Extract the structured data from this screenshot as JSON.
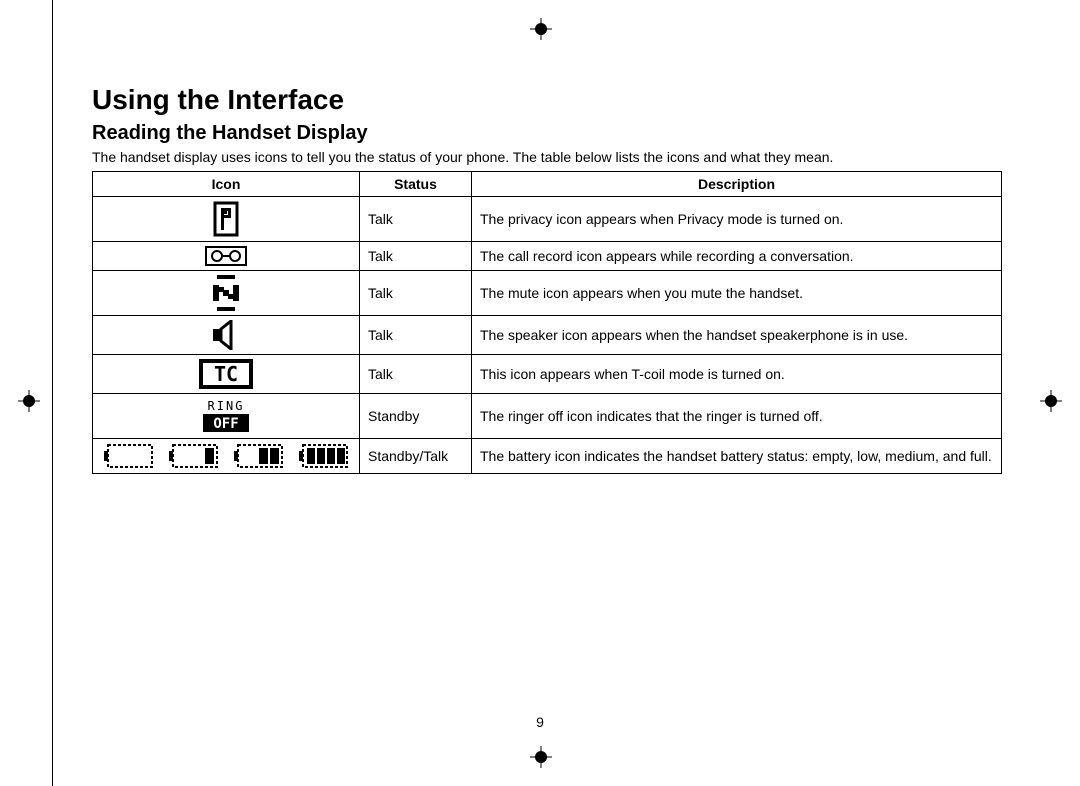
{
  "page": {
    "title": "Using the Interface",
    "section": "Reading the Handset Display",
    "intro": "The handset display uses icons to tell you the status of your phone. The table below lists the icons and what they mean.",
    "number": "9"
  },
  "table": {
    "headers": {
      "icon": "Icon",
      "status": "Status",
      "description": "Description"
    },
    "rows": [
      {
        "icon_name": "privacy-icon",
        "status": "Talk",
        "description": "The privacy icon appears when Privacy mode is turned on."
      },
      {
        "icon_name": "call-record-icon",
        "status": "Talk",
        "description": "The call record icon appears while recording a conversation."
      },
      {
        "icon_name": "mute-icon",
        "status": "Talk",
        "description": "The mute icon appears when you mute the handset."
      },
      {
        "icon_name": "speaker-icon",
        "status": "Talk",
        "description": "The speaker icon appears when the handset speakerphone is in use."
      },
      {
        "icon_name": "t-coil-icon",
        "status": "Talk",
        "description": "This icon appears when T-coil mode is turned on."
      },
      {
        "icon_name": "ringer-off-icon",
        "status": "Standby",
        "description": "The ringer off icon indicates that the ringer is turned off."
      },
      {
        "icon_name": "battery-icons",
        "status": "Standby/Talk",
        "description": "The battery icon indicates the handset battery status: empty, low, medium, and full."
      }
    ]
  }
}
